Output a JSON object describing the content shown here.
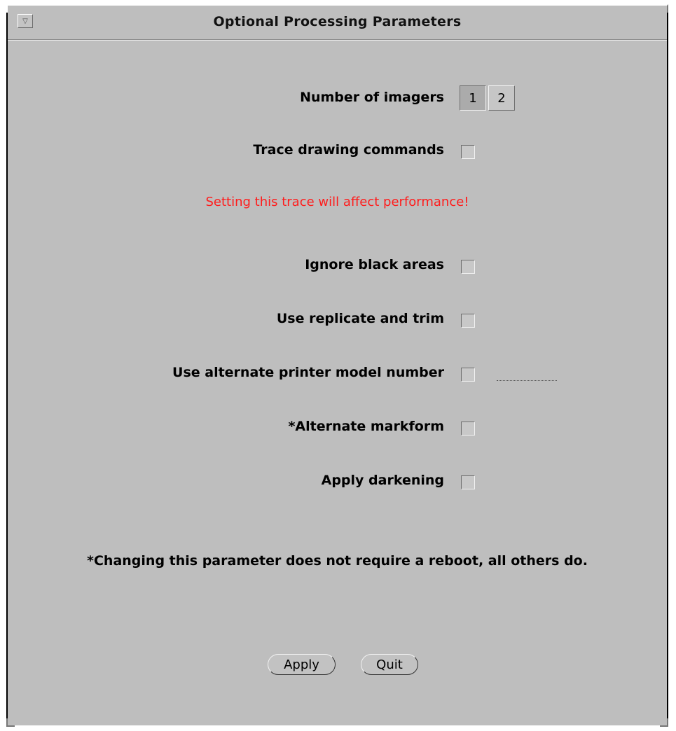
{
  "window": {
    "title": "Optional Processing Parameters",
    "menu_icon": "triangle-down-icon"
  },
  "imagers": {
    "label": "Number of imagers",
    "options": [
      "1",
      "2"
    ],
    "selected": "1"
  },
  "trace": {
    "label": "Trace drawing commands",
    "checked": false,
    "warning": "Setting this trace will affect performance!"
  },
  "options": {
    "ignore_black": {
      "label": "Ignore black areas",
      "checked": false
    },
    "replicate_trim": {
      "label": "Use replicate and trim",
      "checked": false
    },
    "alt_printer_model": {
      "label": "Use alternate printer model number",
      "checked": false,
      "value": ""
    },
    "alt_markform": {
      "label": "*Alternate markform",
      "checked": false
    },
    "apply_darkening": {
      "label": "Apply darkening",
      "checked": false
    }
  },
  "note": "*Changing this parameter does not require a reboot, all others do.",
  "buttons": {
    "apply": "Apply",
    "quit": "Quit"
  },
  "colors": {
    "background": "#bebebe",
    "warning": "#ff1c1c"
  }
}
